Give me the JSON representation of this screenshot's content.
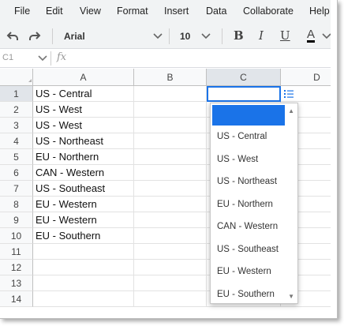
{
  "menubar": {
    "items": [
      "File",
      "Edit",
      "View",
      "Format",
      "Insert",
      "Data",
      "Collaborate",
      "Help"
    ]
  },
  "toolbar": {
    "font_name": "Arial",
    "font_size": "10",
    "bold_label": "B",
    "italic_label": "I",
    "underline_label": "U",
    "text_color_label": "A",
    "text_color": "#000000"
  },
  "formulabar": {
    "name_box": "C1",
    "fx_label": "fx"
  },
  "grid": {
    "columns": [
      "A",
      "B",
      "C",
      "D"
    ],
    "rows": [
      "1",
      "2",
      "3",
      "4",
      "5",
      "6",
      "7",
      "8",
      "9",
      "10",
      "11",
      "12",
      "13",
      "14"
    ],
    "column_a": [
      "US - Central",
      "US - West",
      "US - West",
      "US - Northeast",
      "EU - Northern",
      "CAN - Western",
      "US - Southeast",
      "EU - Western",
      "EU - Western",
      "EU - Southern",
      "",
      "",
      "",
      ""
    ],
    "active_cell": "C1",
    "active_value": ""
  },
  "dropdown": {
    "selected": "",
    "options": [
      "US - Central",
      "US - West",
      "US - Northeast",
      "EU - Northern",
      "CAN - Western",
      "US - Southeast",
      "EU - Western",
      "EU - Southern"
    ]
  },
  "colors": {
    "accent": "#1a73e8",
    "header_bg": "#f8f9fa",
    "toolbar_bg": "#f1f3f4"
  }
}
